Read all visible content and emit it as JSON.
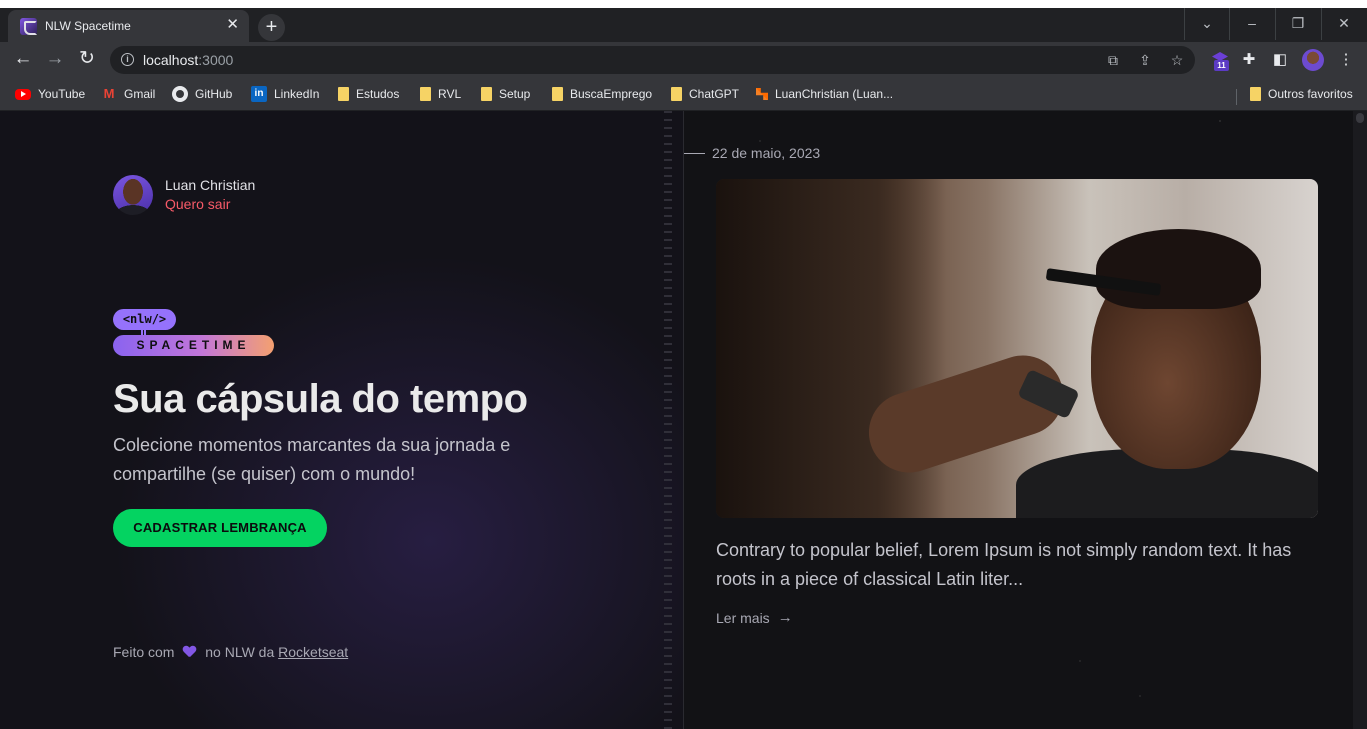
{
  "browser": {
    "tab_title": "NLW Spacetime",
    "tab_close": "✕",
    "new_tab": "+",
    "url_host": "localhost",
    "url_port": ":3000",
    "window_controls": {
      "collapse": "⌄",
      "minimize": "–",
      "restore": "❐",
      "close": "✕"
    },
    "extension_badge": "11"
  },
  "bookmarks": [
    {
      "label": "YouTube",
      "icon": "youtube-icon"
    },
    {
      "label": "Gmail",
      "icon": "gmail-icon"
    },
    {
      "label": "GitHub",
      "icon": "github-icon"
    },
    {
      "label": "LinkedIn",
      "icon": "linkedin-icon"
    },
    {
      "label": "Estudos",
      "icon": "folder-icon"
    },
    {
      "label": "RVL",
      "icon": "folder-icon"
    },
    {
      "label": "Setup",
      "icon": "folder-icon"
    },
    {
      "label": "BuscaEmprego",
      "icon": "folder-icon"
    },
    {
      "label": "ChatGPT",
      "icon": "folder-icon"
    },
    {
      "label": "LuanChristian (Luan...",
      "icon": "leetcode-icon"
    },
    {
      "label": "Outros favoritos",
      "icon": "folder-icon"
    }
  ],
  "user": {
    "name": "Luan Christian",
    "logout_label": "Quero sair"
  },
  "logo": {
    "top": "<nlw/>",
    "bottom": "SPACETIME"
  },
  "hero": {
    "title": "Sua cápsula do tempo",
    "subtitle": "Colecione momentos marcantes da sua jornada e compartilhe (se quiser) com o mundo!",
    "cta_label": "CADASTRAR LEMBRANÇA"
  },
  "footer": {
    "prefix": "Feito com",
    "middle": "no NLW da",
    "link": "Rocketseat"
  },
  "memory": {
    "date": "22 de maio, 2023",
    "excerpt": "Contrary to popular belief, Lorem Ipsum is not simply random text. It has roots in a piece of classical Latin liter...",
    "read_more": "Ler mais",
    "read_more_arrow": "→"
  },
  "colors": {
    "accent_purple": "#8257e5",
    "cta_green": "#04d361",
    "logout_red": "#f75a68",
    "background": "#121215"
  }
}
